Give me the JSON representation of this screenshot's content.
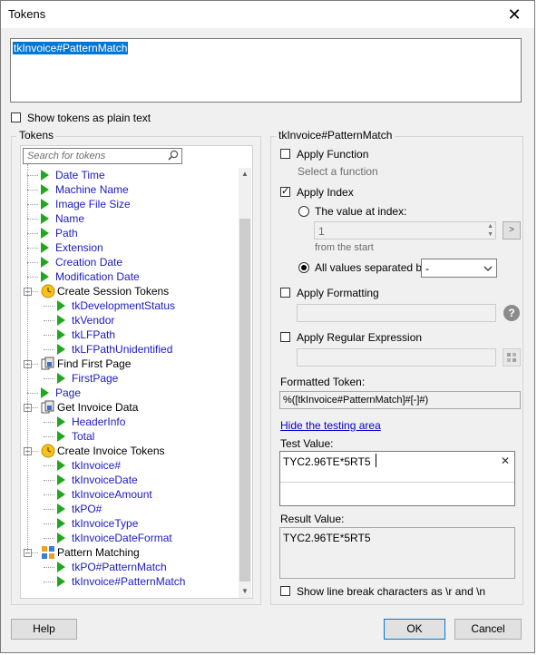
{
  "window": {
    "title": "Tokens",
    "close_glyph": "✕"
  },
  "token_editor": {
    "value": "tkInvoice#PatternMatch"
  },
  "show_plain_text": {
    "label": "Show tokens as plain text",
    "checked": false
  },
  "tokens_panel": {
    "title": "Tokens",
    "search_placeholder": "Search for tokens",
    "items": [
      {
        "label": "Date Time",
        "type": "token",
        "level": 1
      },
      {
        "label": "Machine Name",
        "type": "token",
        "level": 1
      },
      {
        "label": "Image File Size",
        "type": "token",
        "level": 1
      },
      {
        "label": "Name",
        "type": "token",
        "level": 1
      },
      {
        "label": "Path",
        "type": "token",
        "level": 1
      },
      {
        "label": "Extension",
        "type": "token",
        "level": 1
      },
      {
        "label": "Creation Date",
        "type": "token",
        "level": 1
      },
      {
        "label": "Modification Date",
        "type": "token",
        "level": 1
      },
      {
        "label": "Create Session Tokens",
        "type": "group-session",
        "level": 1
      },
      {
        "label": "tkDevelopmentStatus",
        "type": "token",
        "level": 2
      },
      {
        "label": "tkVendor",
        "type": "token",
        "level": 2
      },
      {
        "label": "tkLFPath",
        "type": "token",
        "level": 2
      },
      {
        "label": "tkLFPathUnidentified",
        "type": "token",
        "level": 2
      },
      {
        "label": "Find First Page",
        "type": "group-activity",
        "level": 1
      },
      {
        "label": "FirstPage",
        "type": "token",
        "level": 2
      },
      {
        "label": "Page",
        "type": "token",
        "level": 1
      },
      {
        "label": "Get Invoice Data",
        "type": "group-activity",
        "level": 1
      },
      {
        "label": "HeaderInfo",
        "type": "token",
        "level": 2
      },
      {
        "label": "Total",
        "type": "token",
        "level": 2
      },
      {
        "label": "Create Invoice Tokens",
        "type": "group-session",
        "level": 1
      },
      {
        "label": "tkInvoice#",
        "type": "token",
        "level": 2
      },
      {
        "label": "tkInvoiceDate",
        "type": "token",
        "level": 2
      },
      {
        "label": "tkInvoiceAmount",
        "type": "token",
        "level": 2
      },
      {
        "label": "tkPO#",
        "type": "token",
        "level": 2
      },
      {
        "label": "tkInvoiceType",
        "type": "token",
        "level": 2
      },
      {
        "label": "tkInvoiceDateFormat",
        "type": "token",
        "level": 2
      },
      {
        "label": "Pattern Matching",
        "type": "group-pattern",
        "level": 1
      },
      {
        "label": "tkPO#PatternMatch",
        "type": "token",
        "level": 2
      },
      {
        "label": "tkInvoice#PatternMatch",
        "type": "token",
        "level": 2
      }
    ]
  },
  "details": {
    "title": "tkInvoice#PatternMatch",
    "apply_function": {
      "label": "Apply Function",
      "checked": false,
      "hint": "Select a function"
    },
    "apply_index": {
      "label": "Apply Index",
      "checked": true,
      "value_at_index_label": "The value at index:",
      "index_value": "1",
      "from_start_label": "from the  start",
      "next_glyph": ">",
      "all_values_label": "All values separated by:",
      "separator_value": "-",
      "mode": "all"
    },
    "apply_formatting": {
      "label": "Apply Formatting",
      "checked": false,
      "help_glyph": "?"
    },
    "apply_regex": {
      "label": "Apply Regular Expression",
      "checked": false
    },
    "formatted_token_label": "Formatted Token:",
    "formatted_token_value": "%([tkInvoice#PatternMatch]#[-]#)",
    "hide_testing_link": "Hide the testing area",
    "test_value_label": "Test Value:",
    "test_value": "TYC2.96TE*5RT5",
    "clear_glyph": "✕",
    "result_value_label": "Result Value:",
    "result_value": "TYC2.96TE*5RT5",
    "show_line_breaks": {
      "label": "Show line break characters as \\r and \\n",
      "checked": false
    }
  },
  "footer": {
    "help_label": "Help",
    "ok_label": "OK",
    "cancel_label": "Cancel"
  }
}
